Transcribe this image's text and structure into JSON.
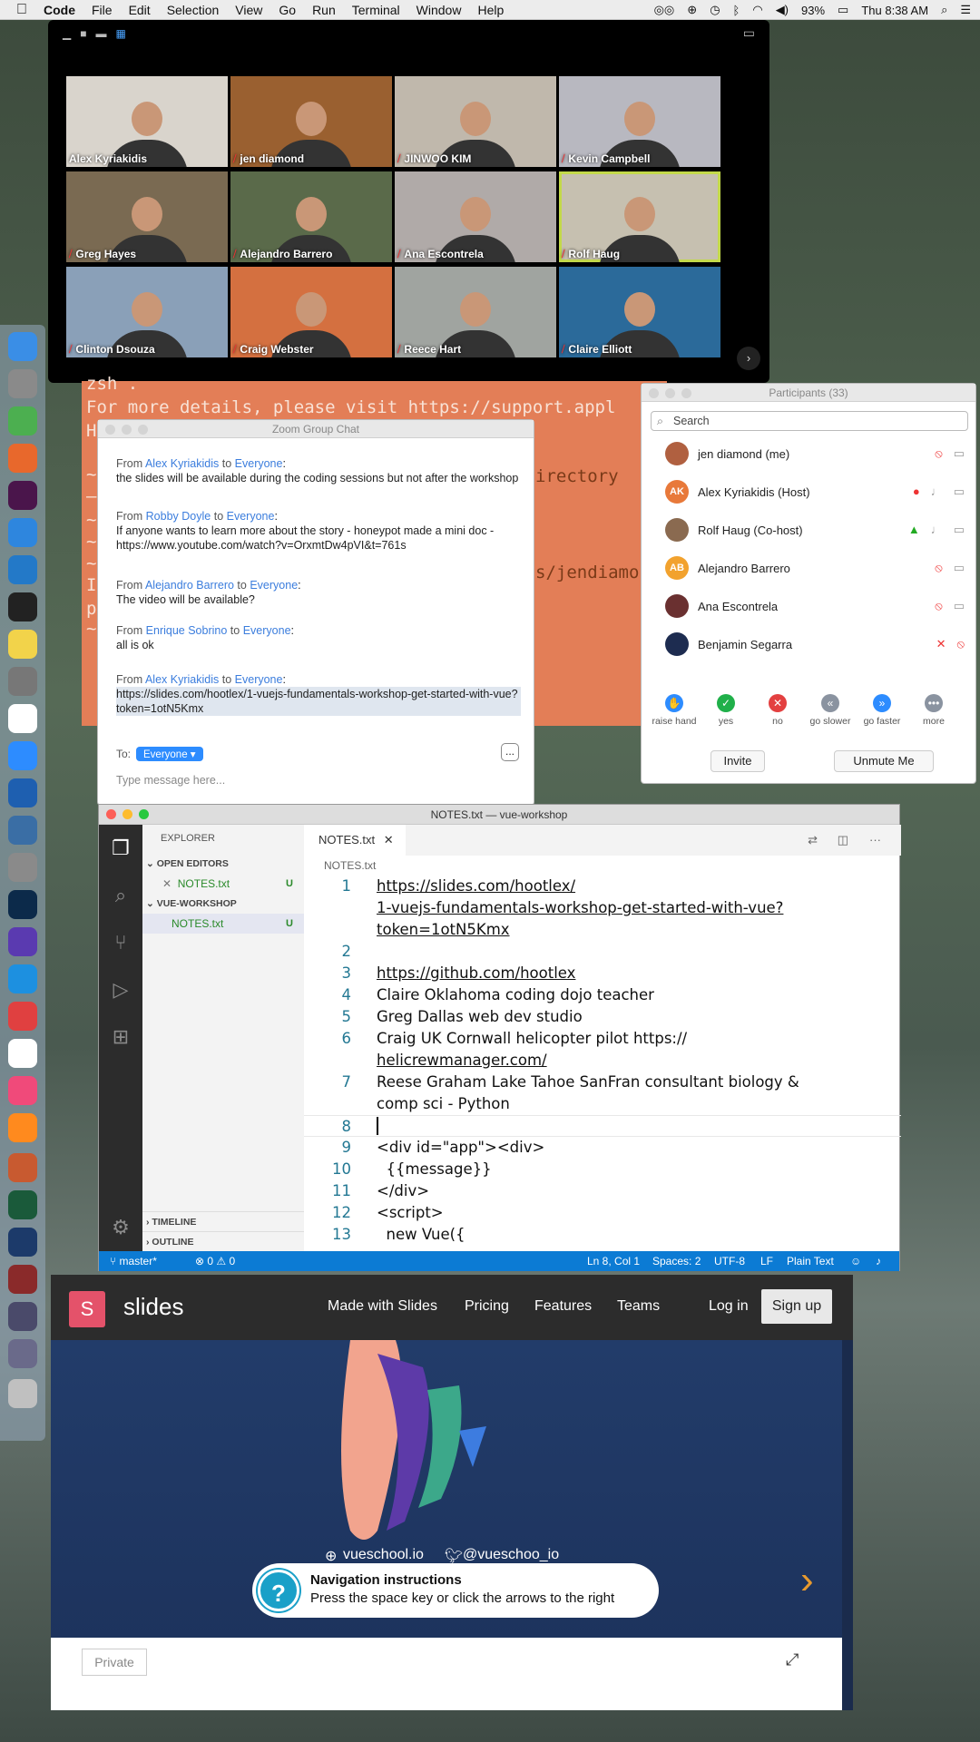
{
  "menubar": {
    "app": "Code",
    "items": [
      "File",
      "Edit",
      "Selection",
      "View",
      "Go",
      "Run",
      "Terminal",
      "Window",
      "Help"
    ],
    "battery": "93%",
    "time": "Thu 8:38 AM"
  },
  "zoom": {
    "tiles": [
      {
        "name": "Alex Kyriakidis",
        "muted": false
      },
      {
        "name": "jen diamond",
        "muted": true
      },
      {
        "name": "JINWOO KIM",
        "muted": true
      },
      {
        "name": "Kevin Campbell",
        "muted": true
      },
      {
        "name": "Greg Hayes",
        "muted": true
      },
      {
        "name": "Alejandro Barrero",
        "muted": true
      },
      {
        "name": "Ana Escontrela",
        "muted": true
      },
      {
        "name": "Rolf Haug",
        "muted": true
      },
      {
        "name": "Clinton Dsouza",
        "muted": true
      },
      {
        "name": "Craig Webster",
        "muted": true
      },
      {
        "name": "Reece Hart",
        "muted": true
      },
      {
        "name": "Claire Elliott",
        "muted": true
      }
    ]
  },
  "terminal": {
    "lines": [
      "zsh .",
      "For more details, please visit https://support.appl",
      "H",
      "~",
      "—",
      "~",
      "~",
      "~",
      "I",
      "p",
      "~"
    ],
    "right_fragments": [
      "irectory",
      "s/jendiamo"
    ]
  },
  "chat": {
    "title": "Zoom Group Chat",
    "messages": [
      {
        "from": "Alex Kyriakidis",
        "to": "Everyone",
        "text": "the slides will be available during the coding sessions but not after the workshop"
      },
      {
        "from": "Robby Doyle",
        "to": "Everyone",
        "text": "If anyone wants to learn more about the story - honeypot made a mini doc - https://www.youtube.com/watch?v=OrxmtDw4pVI&t=761s"
      },
      {
        "from": "Alejandro Barrero",
        "to": "Everyone",
        "text": "The video will be available?"
      },
      {
        "from": "Enrique Sobrino",
        "to": "Everyone",
        "text": "all is ok"
      },
      {
        "from": "Alex Kyriakidis",
        "to": "Everyone",
        "text": "https://slides.com/hootlex/1-vuejs-fundamentals-workshop-get-started-with-vue?token=1otN5Kmx"
      }
    ],
    "from_label": "From",
    "to_label": "to",
    "to_prefix": "To:",
    "recipient": "Everyone",
    "placeholder": "Type message here...",
    "more": "..."
  },
  "participants": {
    "title": "Participants (33)",
    "search_placeholder": "Search",
    "list": [
      {
        "name": "jen diamond (me)",
        "initials": "",
        "color": "#b06040"
      },
      {
        "name": "Alex Kyriakidis (Host)",
        "initials": "AK",
        "color": "#e8793a"
      },
      {
        "name": "Rolf Haug (Co-host)",
        "initials": "",
        "color": "#8a6a50"
      },
      {
        "name": "Alejandro Barrero",
        "initials": "AB",
        "color": "#f2a22e"
      },
      {
        "name": "Ana Escontrela",
        "initials": "",
        "color": "#6a3030"
      },
      {
        "name": "Benjamin Segarra",
        "initials": "",
        "color": "#1d2c50"
      }
    ],
    "reactions": [
      {
        "label": "raise hand",
        "icon": "✋",
        "color": "#2d8cff"
      },
      {
        "label": "yes",
        "icon": "✓",
        "color": "#20b04a"
      },
      {
        "label": "no",
        "icon": "✕",
        "color": "#e34040"
      },
      {
        "label": "go slower",
        "icon": "«",
        "color": "#8a93a0"
      },
      {
        "label": "go faster",
        "icon": "»",
        "color": "#2d8cff"
      },
      {
        "label": "more",
        "icon": "•••",
        "color": "#8a93a0"
      }
    ],
    "invite": "Invite",
    "unmute": "Unmute Me"
  },
  "vscode": {
    "title": "NOTES.txt — vue-workshop",
    "explorer": "EXPLORER",
    "open_editors": "OPEN EDITORS",
    "workspace": "VUE-WORKSHOP",
    "file": "NOTES.txt",
    "u": "U",
    "timeline": "TIMELINE",
    "outline": "OUTLINE",
    "tab": "NOTES.txt",
    "crumb": "NOTES.txt",
    "lines": [
      {
        "n": "1",
        "t": "https://slides.com/hootlex/",
        "link": true
      },
      {
        "n": "",
        "t": "1-vuejs-fundamentals-workshop-get-started-with-vue?",
        "link": true
      },
      {
        "n": "",
        "t": "token=1otN5Kmx",
        "link": true
      },
      {
        "n": "2",
        "t": "",
        "link": false
      },
      {
        "n": "3",
        "t": "https://github.com/hootlex",
        "link": true
      },
      {
        "n": "4",
        "t": "Claire Oklahoma coding dojo teacher",
        "link": false
      },
      {
        "n": "5",
        "t": "Greg Dallas web dev studio",
        "link": false
      },
      {
        "n": "6",
        "t": "Craig UK Cornwall helicopter pilot https://",
        "link": false
      },
      {
        "n": "",
        "t": "helicrewmanager.com/",
        "link": true
      },
      {
        "n": "7",
        "t": "Reese Graham Lake Tahoe SanFran consultant biology &",
        "link": false
      },
      {
        "n": "",
        "t": "comp sci - Python",
        "link": false
      },
      {
        "n": "8",
        "t": "",
        "link": false
      },
      {
        "n": "9",
        "t": "<div id=\"app\"><div>",
        "link": false
      },
      {
        "n": "10",
        "t": "  {{message}}",
        "link": false
      },
      {
        "n": "11",
        "t": "</div>",
        "link": false
      },
      {
        "n": "12",
        "t": "<script>",
        "link": false
      },
      {
        "n": "13",
        "t": "  new Vue({",
        "link": false
      }
    ],
    "status": {
      "branch": "master*",
      "problems": "⊗ 0 ⚠ 0",
      "pos": "Ln 8, Col 1",
      "spaces": "Spaces: 2",
      "enc": "UTF-8",
      "eol": "LF",
      "lang": "Plain Text"
    }
  },
  "browser": {
    "logo": "S",
    "brand": "slides",
    "nav": [
      "Made with Slides",
      "Pricing",
      "Features",
      "Teams",
      "Log in"
    ],
    "signup": "Sign up",
    "site": "vueschool.io",
    "twitter": "@vueschoo_io",
    "nav_title": "Navigation instructions",
    "nav_text": "Press the space key or click the arrows to the right",
    "private": "Private"
  },
  "colors": {
    "accent": "#2d8cff",
    "vscode_status": "#0c7bd4",
    "terminal": "#e37e57"
  }
}
